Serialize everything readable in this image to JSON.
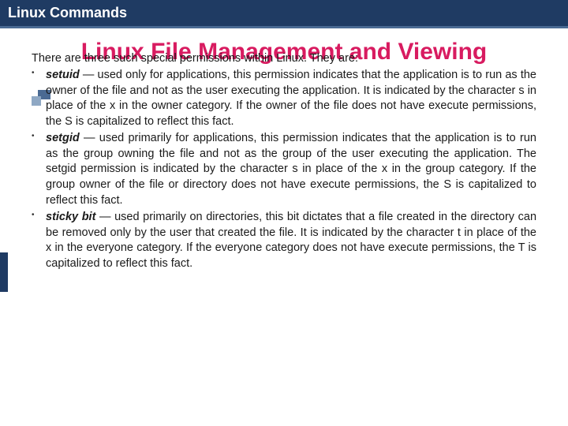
{
  "header": "Linux Commands",
  "title": "Linux File Management and Viewing",
  "intro": "There are three such special permissions within Linux. They are:",
  "permissions": [
    {
      "term": "setuid",
      "desc": " — used only for applications, this permission indicates that the application is to run as the owner of the file and not as the user executing the application. It is indicated by the character s in place of the x in the owner category. If the owner of the file does not have execute permissions, the S is capitalized to reflect this fact."
    },
    {
      "term": "setgid",
      "desc": " — used primarily for applications, this permission indicates that the application is to run as the group owning the file and not as the group of the user executing the application. The setgid permission is indicated by the character s in place of the x in the group category. If the group owner of the file or directory does not have execute permissions, the S is capitalized to reflect this fact."
    },
    {
      "term": "sticky bit",
      "desc": " — used primarily on directories, this bit dictates that a file created in the directory can be removed only by the user that created the file. It is indicated by the character t in place of the x in the everyone category. If the everyone category does not have execute permissions, the T is capitalized to reflect this fact."
    }
  ]
}
